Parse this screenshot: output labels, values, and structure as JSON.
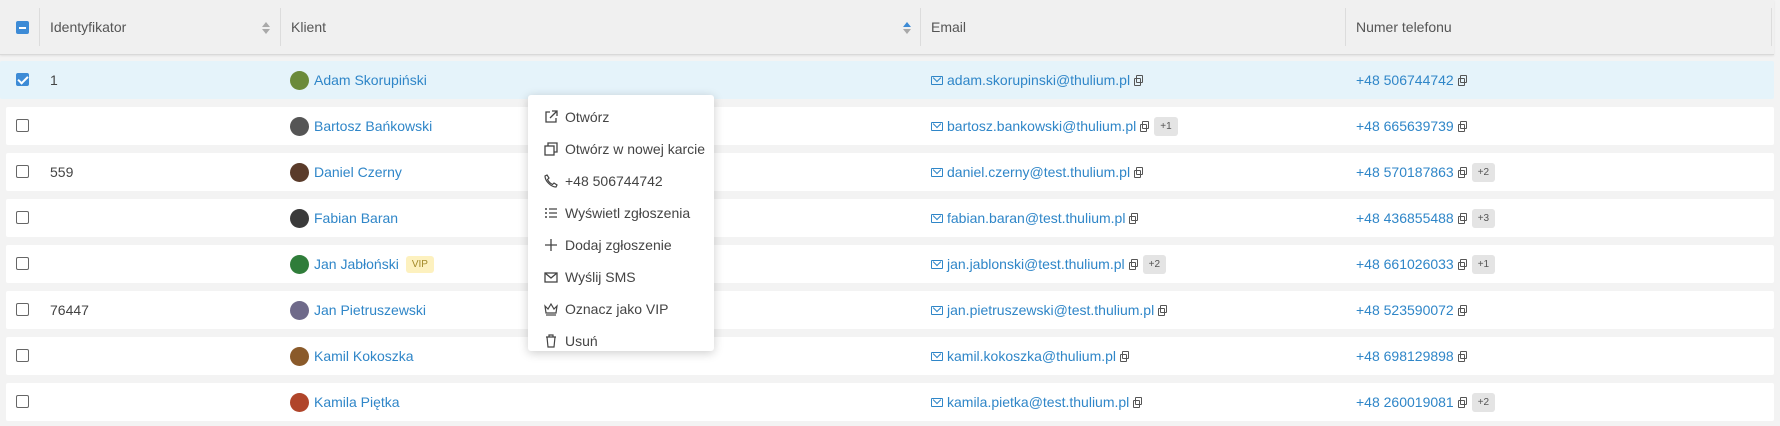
{
  "header": {
    "identyfikator": "Identyfikator",
    "klient": "Klient",
    "email": "Email",
    "numer_telefonu": "Numer telefonu"
  },
  "rows": [
    {
      "id": "1",
      "client": "Adam Skorupiński",
      "email": "adam.skorupinski@thulium.pl",
      "email_more": "",
      "phone": "+48 506744742",
      "phone_more": "",
      "vip": "",
      "selected": true,
      "avatar_color": "#6b8a3a"
    },
    {
      "id": "",
      "client": "Bartosz Bańkowski",
      "email": "bartosz.bankowski@thulium.pl",
      "email_more": "+1",
      "phone": "+48 665639739",
      "phone_more": "",
      "vip": "",
      "selected": false,
      "avatar_color": "#555555"
    },
    {
      "id": "559",
      "client": "Daniel Czerny",
      "email": "daniel.czerny@test.thulium.pl",
      "email_more": "",
      "phone": "+48 570187863",
      "phone_more": "+2",
      "vip": "",
      "selected": false,
      "avatar_color": "#5a3b2a"
    },
    {
      "id": "",
      "client": "Fabian Baran",
      "email": "fabian.baran@test.thulium.pl",
      "email_more": "",
      "phone": "+48 436855488",
      "phone_more": "+3",
      "vip": "",
      "selected": false,
      "avatar_color": "#3a3a3a"
    },
    {
      "id": "",
      "client": "Jan Jabłoński",
      "email": "jan.jablonski@test.thulium.pl",
      "email_more": "+2",
      "phone": "+48 661026033",
      "phone_more": "+1",
      "vip": "VIP",
      "selected": false,
      "avatar_color": "#2f7d3a"
    },
    {
      "id": "76447",
      "client": "Jan Pietruszewski",
      "email": "jan.pietruszewski@test.thulium.pl",
      "email_more": "",
      "phone": "+48 523590072",
      "phone_more": "",
      "vip": "",
      "selected": false,
      "avatar_color": "#6f6a8a"
    },
    {
      "id": "",
      "client": "Kamil Kokoszka",
      "email": "kamil.kokoszka@thulium.pl",
      "email_more": "",
      "phone": "+48 698129898",
      "phone_more": "",
      "vip": "",
      "selected": false,
      "avatar_color": "#8a5a2a"
    },
    {
      "id": "",
      "client": "Kamila Piętka",
      "email": "kamila.pietka@test.thulium.pl",
      "email_more": "",
      "phone": "+48 260019081",
      "phone_more": "+2",
      "vip": "",
      "selected": false,
      "avatar_color": "#b0452a"
    }
  ],
  "context_menu": {
    "items": [
      {
        "label": "Otwórz",
        "icon": "external-link-icon"
      },
      {
        "label": "Otwórz w nowej karcie",
        "icon": "new-tab-icon"
      },
      {
        "label": "+48 506744742",
        "icon": "phone-icon"
      },
      {
        "label": "Wyświetl zgłoszenia",
        "icon": "list-icon"
      },
      {
        "label": "Dodaj zgłoszenie",
        "icon": "plus-icon"
      },
      {
        "label": "Wyślij SMS",
        "icon": "envelope-icon"
      },
      {
        "label": "Oznacz jako VIP",
        "icon": "crown-icon"
      },
      {
        "label": "Usuń",
        "icon": "trash-icon"
      }
    ]
  },
  "colors": {
    "accent": "#2f86c8",
    "selected_row": "#e5f3fa",
    "vip_badge": "#fdf1bf"
  }
}
